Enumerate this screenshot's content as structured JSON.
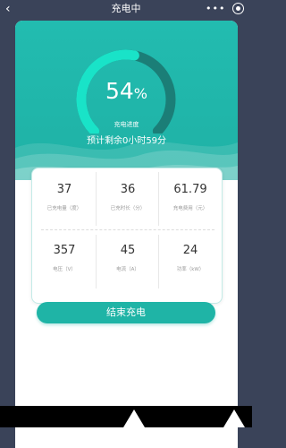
{
  "nav": {
    "back": "‹",
    "title": "充电中",
    "more": "•••",
    "close_icon": "target-circle"
  },
  "progress": {
    "percent": 54,
    "percent_text": "54",
    "unit": "%",
    "label": "充电进度",
    "remaining": "预计剩余0小时59分"
  },
  "stats": [
    {
      "value": "37",
      "label": "已充电量（度）"
    },
    {
      "value": "36",
      "label": "已充时长（分）"
    },
    {
      "value": "61.79",
      "label": "充电费用（元）"
    },
    {
      "value": "357",
      "label": "电压（V）"
    },
    {
      "value": "45",
      "label": "电流（A）"
    },
    {
      "value": "24",
      "label": "功率（kW）"
    }
  ],
  "actions": {
    "end_label": "结束充电"
  },
  "colors": {
    "primary": "#1fb4a6",
    "gauge_active": "#19e3c8",
    "gauge_track": "#1b7e77",
    "background": "#3a4359"
  }
}
